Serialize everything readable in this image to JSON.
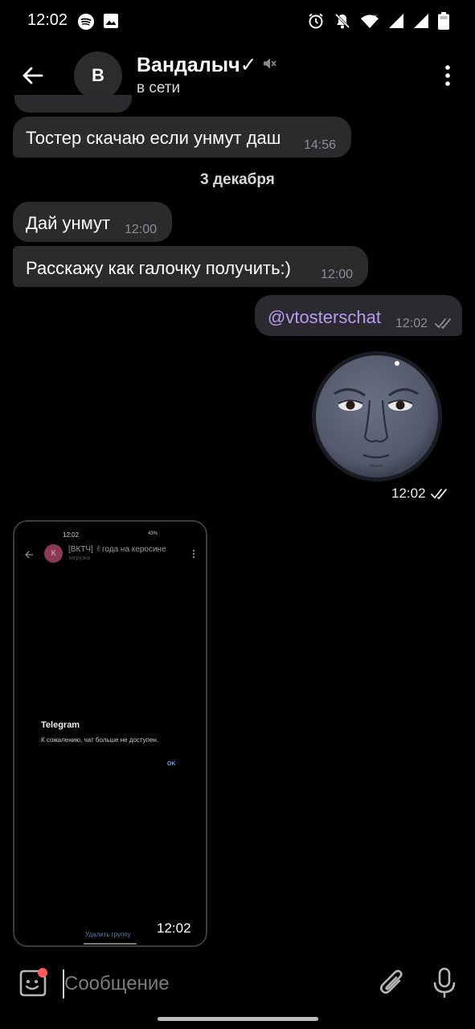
{
  "status_bar": {
    "time": "12:02",
    "icons_left": [
      "spotify-icon",
      "image-icon"
    ],
    "icons_right": [
      "alarm-icon",
      "mute-notifications-icon",
      "wifi-icon",
      "signal-icon",
      "signal-icon",
      "battery-icon"
    ]
  },
  "header": {
    "avatar_letter": "В",
    "title": "Вандалыч✓",
    "status": "в сети",
    "muted_icon": "muted-speaker-icon"
  },
  "messages": [
    {
      "direction": "in",
      "text": "Тостер скачаю если унмут даш",
      "time": "14:56"
    },
    {
      "type": "date",
      "text": "3 декабря"
    },
    {
      "direction": "in",
      "text": "Дай унмут",
      "time": "12:00"
    },
    {
      "direction": "in",
      "text": "Расскажу как галочку получить:)",
      "time": "12:00"
    },
    {
      "direction": "out",
      "text": "@vtosterschat",
      "time": "12:02",
      "read": true
    },
    {
      "direction": "out",
      "type": "sticker",
      "sticker": "moon-face-sticker",
      "time": "12:02",
      "read": true
    },
    {
      "direction": "in",
      "type": "screenshot",
      "time": "12:02"
    }
  ],
  "screenshot_content": {
    "time": "12:02",
    "battery": "43%",
    "chat_avatar": "К",
    "chat_title": "[ВКТЧ] ✌года на керосине",
    "chat_subtitle": "загрузка",
    "dialog_title": "Telegram",
    "dialog_text": "К сожалению, чат больше не доступен.",
    "dialog_ok": "OK",
    "bottom_action": "Удалить группу"
  },
  "input": {
    "placeholder": "Сообщение"
  },
  "colors": {
    "background": "#000000",
    "bubble_in": "#2b2b2d",
    "bubble_out": "#2a2a30",
    "link": "#b89cf0",
    "sticker_badge": "#ff5a5a"
  }
}
